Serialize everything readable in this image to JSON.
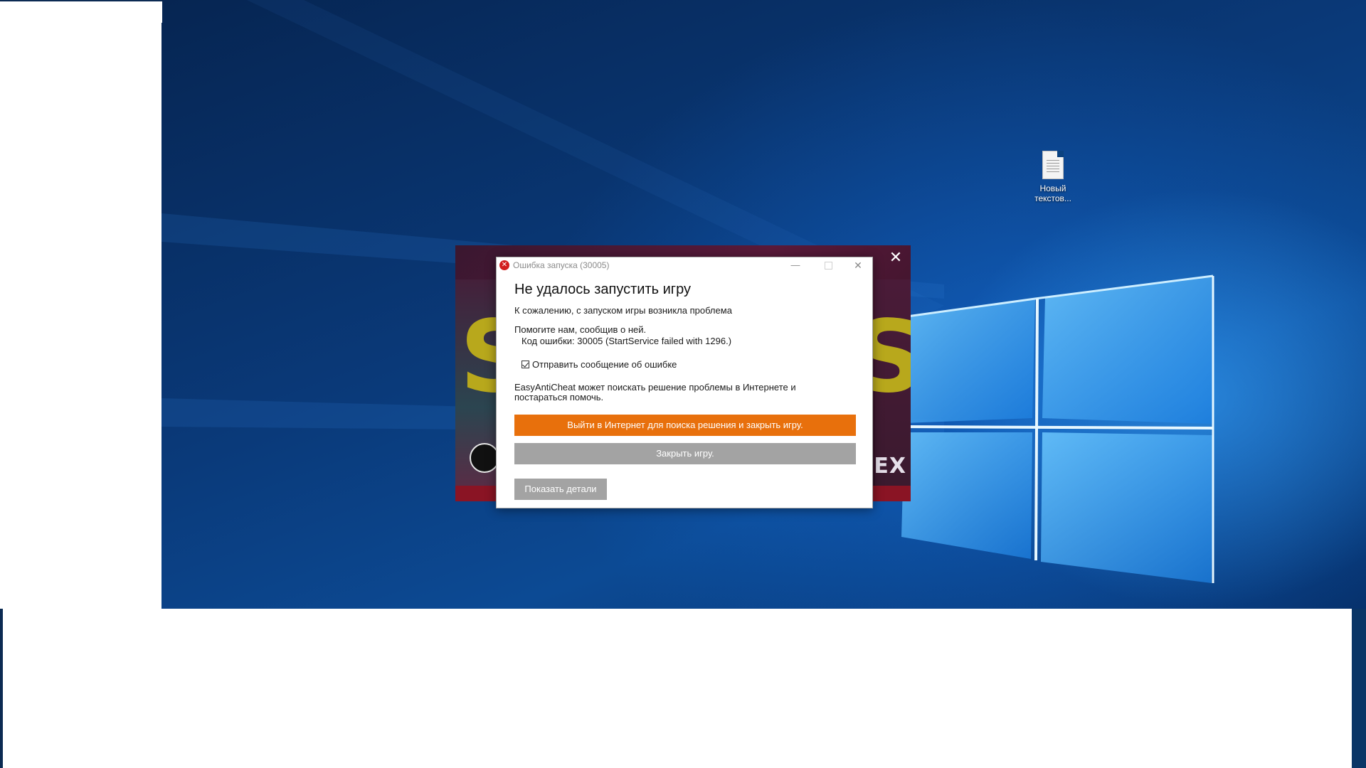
{
  "desktop": {
    "icons": [
      {
        "label_line1": "Новый",
        "label_line2": "текстов...",
        "icon": "text-document-icon"
      }
    ]
  },
  "launcher": {
    "close_glyph": "✕",
    "art_letter_left": "S",
    "art_letter_right": "S",
    "art_text": "PEX"
  },
  "dialog": {
    "title": "Ошибка запуска (30005)",
    "minimize_glyph": "—",
    "close_glyph": "✕",
    "heading": "Не удалось запустить игру",
    "sorry": "К сожалению, с запуском игры возникла проблема",
    "help": "Помогите нам, сообщив о ней.",
    "error_code": "Код ошибки: 30005 (StartService failed with 1296.)",
    "send_report_label": "Отправить сообщение об ошибке",
    "send_report_checked": true,
    "eac_line1": "EasyAntiCheat может поискать решение проблемы в Интернете и",
    "eac_line2": "постараться помочь.",
    "online_button": "Выйти в Интернет для поиска решения и закрыть игру.",
    "close_button": "Закрыть игру.",
    "details_button": "Показать детали",
    "colors": {
      "primary_button": "#e8700c",
      "secondary_button": "#a3a3a3",
      "error_icon": "#d21f1f"
    }
  }
}
